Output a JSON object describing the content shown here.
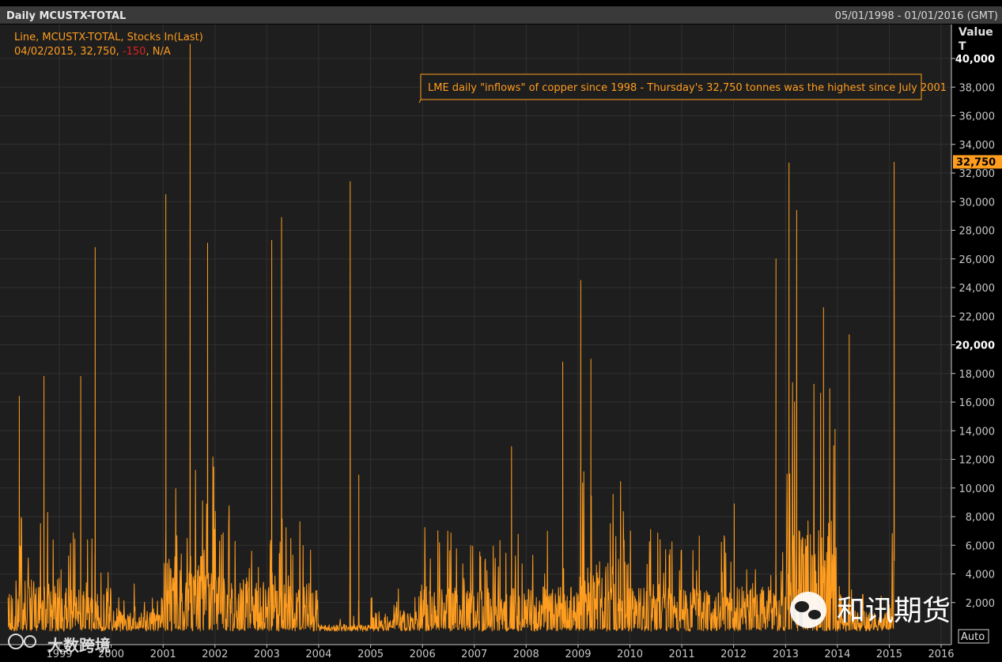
{
  "header": {
    "title": "Daily MCUSTX-TOTAL",
    "date_range": "05/01/1998 - 01/01/2016 (GMT)"
  },
  "legend": {
    "line1": "Line, MCUSTX-TOTAL, Stocks In(Last)",
    "line2_prefix": "04/02/2015, 32,750, ",
    "line2_change": "-150",
    "line2_suffix": ", N/A"
  },
  "annotation": "LME daily \"inflows\" of copper since 1998 - Thursday's 32,750 tonnes was the highest since July 2001",
  "axis": {
    "value_label": "Value",
    "unit_label": "T",
    "auto_button": "Auto",
    "last_value_tag": "32,750"
  },
  "watermarks": {
    "bottom_left": "大数跨境",
    "bottom_right": "和讯期货"
  },
  "colors": {
    "series": "#ff9d1f",
    "background": "#1e1e1e",
    "text": "#c8c8c8",
    "change_negative": "#e02020",
    "tag": "#ff9d1f"
  },
  "chart_data": {
    "type": "line",
    "title": "Daily MCUSTX-TOTAL",
    "series_name": "MCUSTX-TOTAL",
    "ylabel": "Value",
    "yunit": "T",
    "xlim": [
      "1998-01-05",
      "2016-01-01"
    ],
    "ylim": [
      0,
      41000
    ],
    "y_ticks": [
      2000,
      4000,
      6000,
      8000,
      10000,
      12000,
      14000,
      16000,
      18000,
      20000,
      22000,
      24000,
      26000,
      28000,
      30000,
      32000,
      34000,
      36000,
      38000,
      40000
    ],
    "y_tick_labels": [
      "2,000",
      "4,000",
      "6,000",
      "8,000",
      "10,000",
      "12,000",
      "14,000",
      "16,000",
      "18,000",
      "20,000",
      "22,000",
      "24,000",
      "26,000",
      "28,000",
      "30,000",
      "32,000",
      "34,000",
      "36,000",
      "38,000",
      "40,000"
    ],
    "x_ticks": [
      "1999",
      "2000",
      "2001",
      "2002",
      "2003",
      "2004",
      "2005",
      "2006",
      "2007",
      "2008",
      "2009",
      "2010",
      "2011",
      "2012",
      "2013",
      "2014",
      "2015",
      "2016"
    ],
    "grid": true,
    "last_point": {
      "date": "2015-02-04",
      "value": 32750,
      "change": -150
    },
    "peaks": [
      {
        "date": "1998-03-25",
        "value": 16400
      },
      {
        "date": "1998-09-15",
        "value": 17800
      },
      {
        "date": "1999-06-01",
        "value": 17800
      },
      {
        "date": "1999-09-10",
        "value": 26800
      },
      {
        "date": "2001-01-20",
        "value": 30500
      },
      {
        "date": "2001-07-10",
        "value": 41000
      },
      {
        "date": "2001-11-10",
        "value": 27100
      },
      {
        "date": "2003-02-05",
        "value": 27300
      },
      {
        "date": "2003-04-15",
        "value": 28900
      },
      {
        "date": "2004-08-10",
        "value": 31400
      },
      {
        "date": "2004-10-10",
        "value": 10900
      },
      {
        "date": "2007-09-20",
        "value": 12900
      },
      {
        "date": "2008-09-15",
        "value": 18800
      },
      {
        "date": "2009-01-20",
        "value": 24500
      },
      {
        "date": "2009-04-01",
        "value": 19000
      },
      {
        "date": "2012-01-05",
        "value": 8900
      },
      {
        "date": "2012-10-25",
        "value": 26000
      },
      {
        "date": "2013-01-25",
        "value": 32700
      },
      {
        "date": "2013-03-20",
        "value": 29400
      },
      {
        "date": "2013-09-25",
        "value": 22600
      },
      {
        "date": "2013-12-15",
        "value": 14100
      },
      {
        "date": "2014-03-25",
        "value": 20700
      },
      {
        "date": "2015-02-04",
        "value": 32750
      }
    ],
    "baseline_level_by_year": [
      {
        "year": 1998,
        "level": 3000
      },
      {
        "year": 1999,
        "level": 2500
      },
      {
        "year": 2000,
        "level": 1200
      },
      {
        "year": 2001,
        "level": 4500
      },
      {
        "year": 2002,
        "level": 3200
      },
      {
        "year": 2003,
        "level": 2800
      },
      {
        "year": 2004,
        "level": 400
      },
      {
        "year": 2005,
        "level": 1200
      },
      {
        "year": 2006,
        "level": 2600
      },
      {
        "year": 2007,
        "level": 2500
      },
      {
        "year": 2008,
        "level": 2600
      },
      {
        "year": 2009,
        "level": 4200
      },
      {
        "year": 2010,
        "level": 2800
      },
      {
        "year": 2011,
        "level": 2500
      },
      {
        "year": 2012,
        "level": 2600
      },
      {
        "year": 2013,
        "level": 6500
      },
      {
        "year": 2014,
        "level": 1200
      },
      {
        "year": 2015,
        "level": 2500
      }
    ]
  }
}
